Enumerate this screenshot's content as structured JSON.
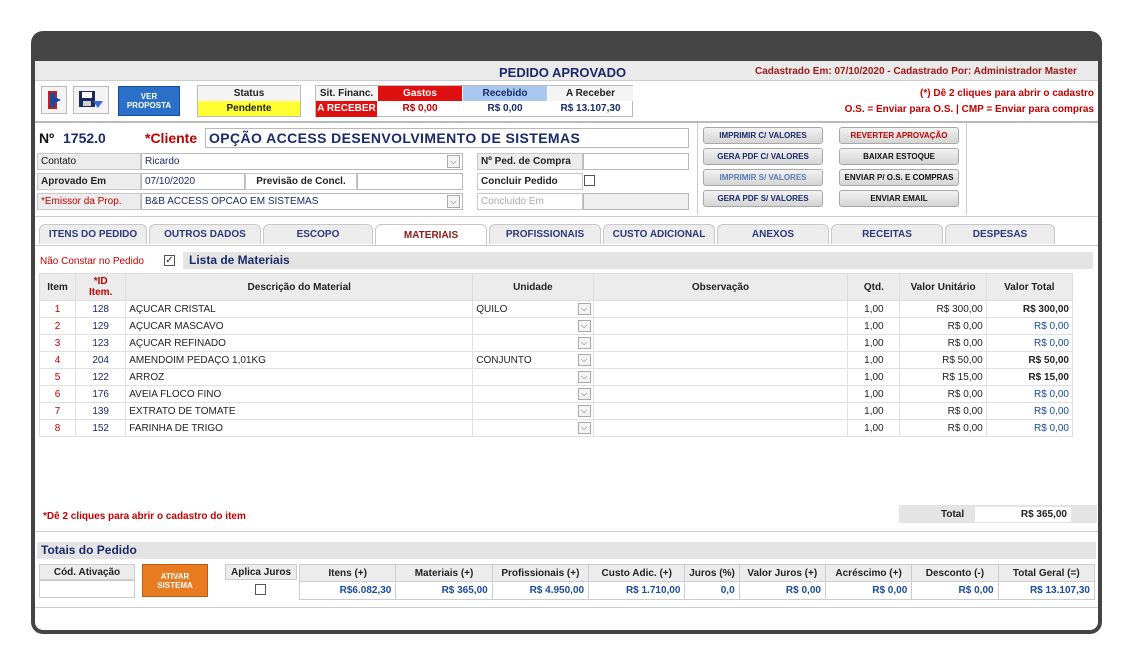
{
  "header": {
    "title": "PEDIDO APROVADO",
    "registered": "Cadastrado Em: 07/10/2020 - Cadastrado Por: Administrador Master",
    "hint1": "(*) Dê 2 cliques para abrir o cadastro",
    "hint2": "O.S. = Enviar para O.S. | CMP = Enviar para compras"
  },
  "toolbar": {
    "ver_proposta_line1": "VER",
    "ver_proposta_line2": "PROPOSTA",
    "status_label": "Status",
    "status_value": "Pendente",
    "sit_financ_label": "Sit. Financ.",
    "a_receber_label": "A RECEBER",
    "gastos_label": "Gastos",
    "gastos_value": "R$ 0,00",
    "recebido_label": "Recebido",
    "recebido_value": "R$ 0,00",
    "areceber_label": "A Receber",
    "areceber_value": "R$ 13.107,30"
  },
  "order": {
    "number_label": "Nº",
    "number": "1752.0",
    "cliente_label": "*Cliente",
    "cliente": "OPÇÃO ACCESS DESENVOLVIMENTO DE SISTEMAS",
    "contato_label": "Contato",
    "contato": "Ricardo",
    "aprovado_label": "Aprovado Em",
    "aprovado": "07/10/2020",
    "previsao_label": "Previsão de Concl.",
    "previsao": "",
    "emissor_label": "*Emissor da Prop.",
    "emissor": "B&B  ACCESS OPCAO EM SISTEMAS",
    "ped_compra_label": "Nº Ped. de Compra",
    "ped_compra": "",
    "concluir_label": "Concluir Pedido",
    "concluido_label": "Concluído Em",
    "concluido": ""
  },
  "actions": {
    "imprimir_cv": "IMPRIMIR C/ VALORES",
    "gera_pdf_cv": "GERA PDF C/ VALORES",
    "imprimir_sv": "IMPRIMIR S/ VALORES",
    "gera_pdf_sv": "GERA PDF S/ VALORES",
    "reverter": "REVERTER APROVAÇÃO",
    "baixar": "BAIXAR ESTOQUE",
    "enviar_os": "ENVIAR P/ O.S. E COMPRAS",
    "enviar_email": "ENVIAR EMAIL"
  },
  "tabs": [
    "ITENS DO PEDIDO",
    "OUTROS DADOS",
    "ESCOPO",
    "MATERIAIS",
    "PROFISSIONAIS",
    "CUSTO ADICIONAL",
    "ANEXOS",
    "RECEITAS",
    "DESPESAS"
  ],
  "materials": {
    "nao_constar": "Não Constar no Pedido",
    "list_title": "Lista de Materiais",
    "columns": {
      "item": "Item",
      "id1": "*ID",
      "id2": "Item.",
      "desc": "Descrição do Material",
      "unidade": "Unidade",
      "obs": "Observação",
      "qtd": "Qtd.",
      "unit": "Valor Unitário",
      "total": "Valor Total"
    },
    "rows": [
      {
        "item": "1",
        "id": "128",
        "desc": "AÇUCAR CRISTAL",
        "unidade": "QUILO",
        "qtd": "1,00",
        "unit": "R$ 300,00",
        "total": "R$ 300,00"
      },
      {
        "item": "2",
        "id": "129",
        "desc": "AÇUCAR MASCAVO",
        "unidade": "",
        "qtd": "1,00",
        "unit": "R$ 0,00",
        "total": "R$ 0,00"
      },
      {
        "item": "3",
        "id": "123",
        "desc": "AÇUCAR REFINADO",
        "unidade": "",
        "qtd": "1,00",
        "unit": "R$ 0,00",
        "total": "R$ 0,00"
      },
      {
        "item": "4",
        "id": "204",
        "desc": "AMENDOIM PEDAÇO 1,01KG",
        "unidade": "CONJUNTO",
        "qtd": "1,00",
        "unit": "R$ 50,00",
        "total": "R$ 50,00"
      },
      {
        "item": "5",
        "id": "122",
        "desc": "ARROZ",
        "unidade": "",
        "qtd": "1,00",
        "unit": "R$ 15,00",
        "total": "R$ 15,00"
      },
      {
        "item": "6",
        "id": "176",
        "desc": "AVEIA FLOCO FINO",
        "unidade": "",
        "qtd": "1,00",
        "unit": "R$ 0,00",
        "total": "R$ 0,00"
      },
      {
        "item": "7",
        "id": "139",
        "desc": "EXTRATO DE TOMATE",
        "unidade": "",
        "qtd": "1,00",
        "unit": "R$ 0,00",
        "total": "R$ 0,00"
      },
      {
        "item": "8",
        "id": "152",
        "desc": "FARINHA DE TRIGO",
        "unidade": "",
        "qtd": "1,00",
        "unit": "R$ 0,00",
        "total": "R$ 0,00"
      }
    ],
    "footer_hint": "*Dê 2 cliques para abrir o cadastro do item",
    "total_label": "Total",
    "total_value": "R$ 365,00"
  },
  "totals": {
    "title": "Totais do Pedido",
    "cod_ativacao_label": "Cód. Ativação",
    "cod_ativacao": "",
    "ativar_line1": "ATIVAR",
    "ativar_line2": "SISTEMA",
    "aplica_juros_label": "Aplica Juros",
    "headers": [
      "Itens (+)",
      "Materiais (+)",
      "Profissionais (+)",
      "Custo Adic. (+)",
      "Juros (%)",
      "Valor Juros (+)",
      "Acréscimo (+)",
      "Desconto (-)",
      "Total Geral (=)"
    ],
    "values": [
      "R$6.082,30",
      "R$ 365,00",
      "R$ 4.950,00",
      "R$ 1.710,00",
      "0,0",
      "R$ 0,00",
      "R$ 0,00",
      "R$ 0,00",
      "R$ 13.107,30"
    ]
  },
  "colors": {
    "frame": "#444444",
    "pending": "#ffff33",
    "gastos": "#e01010",
    "recebido": "#a8c8f0",
    "ativar": "#e87a20"
  }
}
